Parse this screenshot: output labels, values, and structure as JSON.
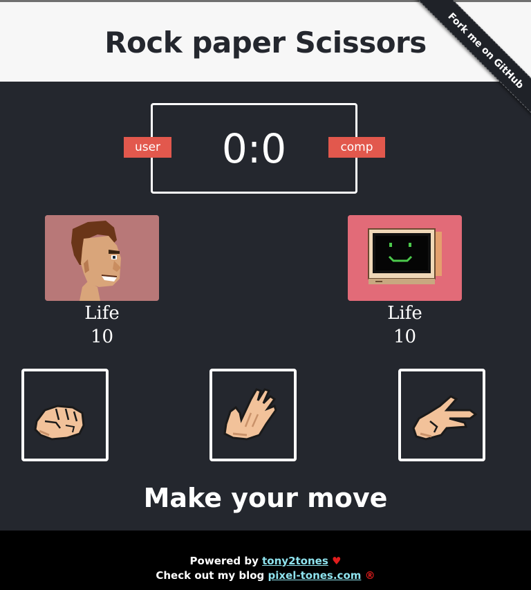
{
  "header": {
    "title": "Rock paper Scissors"
  },
  "ribbon": {
    "label": "Fork me on GitHub"
  },
  "scoreboard": {
    "score": "0:0",
    "user_label": "user",
    "comp_label": "comp"
  },
  "players": {
    "user": {
      "life_label": "Life",
      "life_value": "10"
    },
    "comp": {
      "life_label": "Life",
      "life_value": "10"
    }
  },
  "moves": [
    "rock",
    "paper",
    "scissors"
  ],
  "prompt": "Make your move",
  "footer": {
    "powered_prefix": "Powered by",
    "powered_link": "tony2tones",
    "heart": "♥",
    "blog_prefix": "Check out my blog",
    "blog_link": "pixel-tones.com",
    "reg": "®"
  },
  "colors": {
    "background": "#24272e",
    "header_bg": "#f7f7f7",
    "badge": "#e2584d",
    "user_avatar_bg": "#b87878",
    "comp_avatar_bg": "#e26b78",
    "link": "#8fe3ee",
    "heart": "#e11d1d"
  }
}
